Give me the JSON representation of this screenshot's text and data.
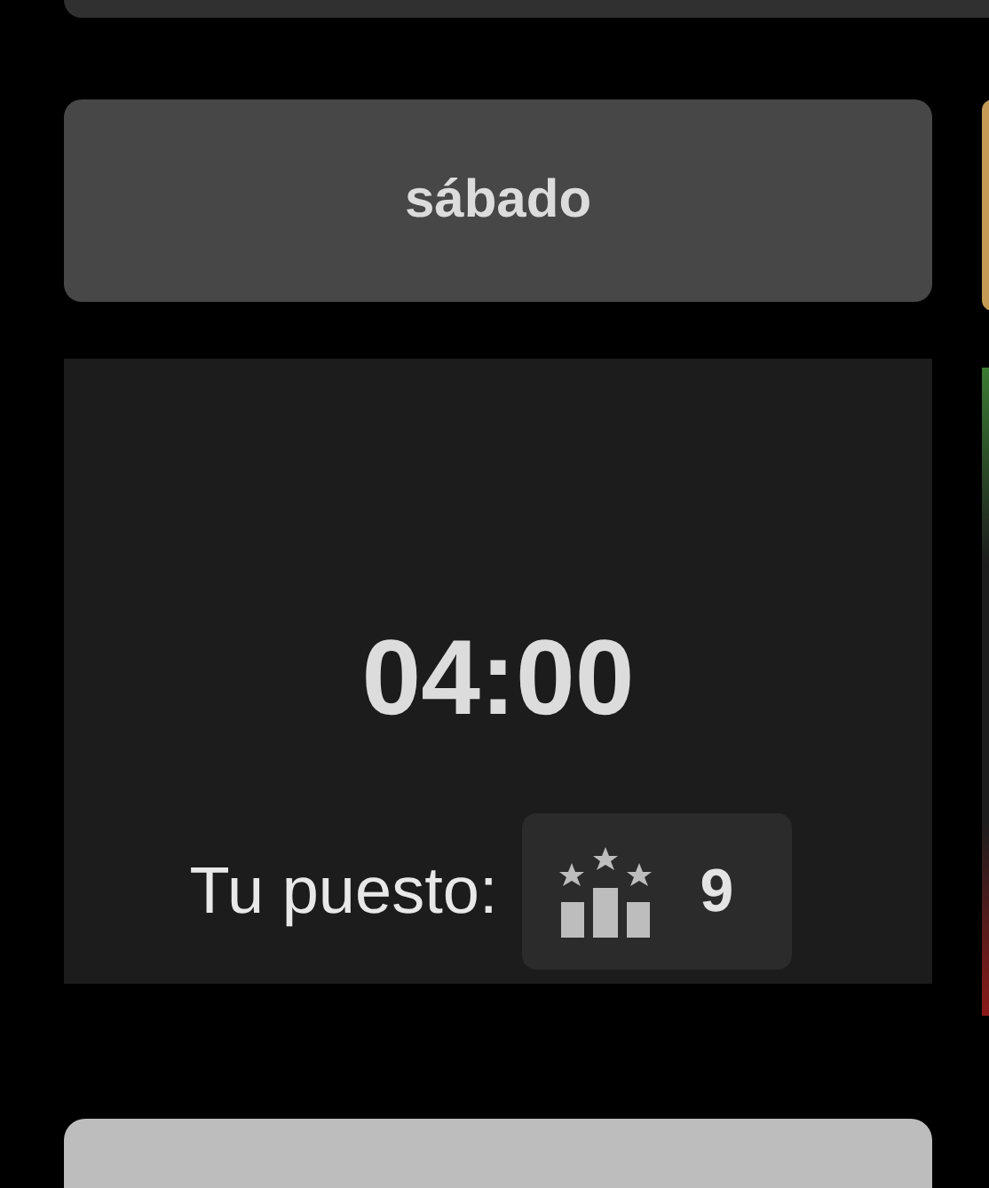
{
  "day": {
    "label": "sábado"
  },
  "result": {
    "time": "04:00",
    "rank_label": "Tu puesto:",
    "rank": "9"
  }
}
